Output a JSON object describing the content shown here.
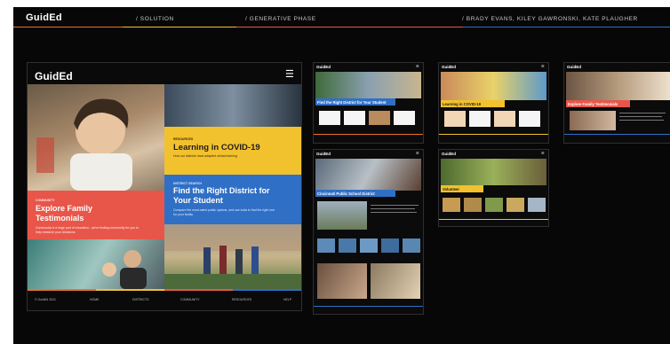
{
  "header": {
    "logo": "GuidEd",
    "breadcrumb_1": "/ SOLUTION",
    "breadcrumb_2": "/ GENERATIVE PHASE",
    "authors": "/ BRADY EVANS, KILEY GAWRONSKI, KATE PLAUGHER"
  },
  "hero": {
    "logo": "GuidEd",
    "menu_icon": "hamburger-menu-icon",
    "covid_eyebrow": "RESOURCES",
    "covid_title": "Learning in COVID-19",
    "covid_desc": "How our districts have adapted virtual learning",
    "district_eyebrow": "DISTRICT SEARCH",
    "district_title_1": "Find the Right District for",
    "district_title_2": "Your Student",
    "district_desc_1": "Compare the most-rated public options, and use tools to find the right one",
    "district_desc_2": "for your family",
    "family_eyebrow": "COMMUNITY",
    "family_title_1": "Explore Family",
    "family_title_2": "Testimonials",
    "family_desc_1": "Community is a huge part of education - we're finding community for you to",
    "family_desc_2": "help research your decisions",
    "footer": {
      "copyright": "© GuidEd 2021",
      "links": [
        "HOME",
        "DISTRICTS",
        "COMMUNITY",
        "RESOURCES",
        "HELP"
      ]
    }
  },
  "thumbs": {
    "logo": "GuidEd",
    "district_title": "Find the Right District for Your Student",
    "covid_title": "Learning in COVID-19",
    "family_title": "Explore Family Testimonials",
    "school_title": "Cincinnati Public School District",
    "volunteer_title": "Volunteer"
  },
  "colors": {
    "accent_orange": "#e9712b",
    "accent_yellow": "#f2c12e",
    "accent_blue": "#2f6fc6",
    "accent_red": "#e8564a"
  }
}
